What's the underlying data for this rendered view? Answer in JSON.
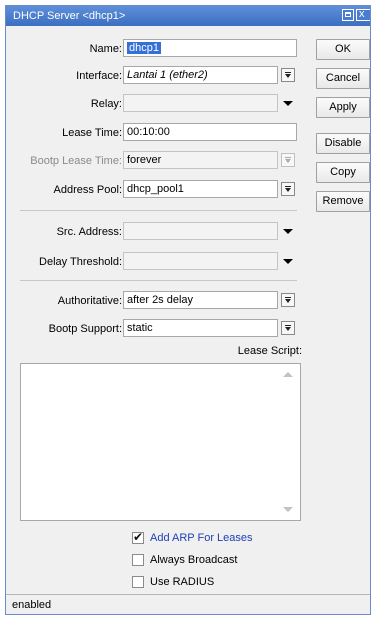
{
  "window": {
    "title": "DHCP Server <dhcp1>"
  },
  "fields": {
    "name": {
      "label": "Name:",
      "value": "dhcp1"
    },
    "interface": {
      "label": "Interface:",
      "value": "Lantai 1 (ether2)"
    },
    "relay": {
      "label": "Relay:",
      "value": ""
    },
    "lease_time": {
      "label": "Lease Time:",
      "value": "00:10:00"
    },
    "bootp_lease_time": {
      "label": "Bootp Lease Time:",
      "value": "forever"
    },
    "address_pool": {
      "label": "Address Pool:",
      "value": "dhcp_pool1"
    },
    "src_address": {
      "label": "Src. Address:",
      "value": ""
    },
    "delay_threshold": {
      "label": "Delay Threshold:",
      "value": ""
    },
    "authoritative": {
      "label": "Authoritative:",
      "value": "after 2s delay"
    },
    "bootp_support": {
      "label": "Bootp Support:",
      "value": "static"
    }
  },
  "lease_script": {
    "label": "Lease Script:",
    "value": ""
  },
  "checkboxes": [
    {
      "label": "Add ARP For Leases",
      "checked": true
    },
    {
      "label": "Always Broadcast",
      "checked": false
    },
    {
      "label": "Use RADIUS",
      "checked": false
    }
  ],
  "buttons": {
    "ok": "OK",
    "cancel": "Cancel",
    "apply": "Apply",
    "disable": "Disable",
    "copy": "Copy",
    "remove": "Remove"
  },
  "status": "enabled",
  "colors": {
    "titlebar": "#4a7ccf",
    "selection": "#3470d6",
    "checkbox_label": "#1f3eb8"
  }
}
